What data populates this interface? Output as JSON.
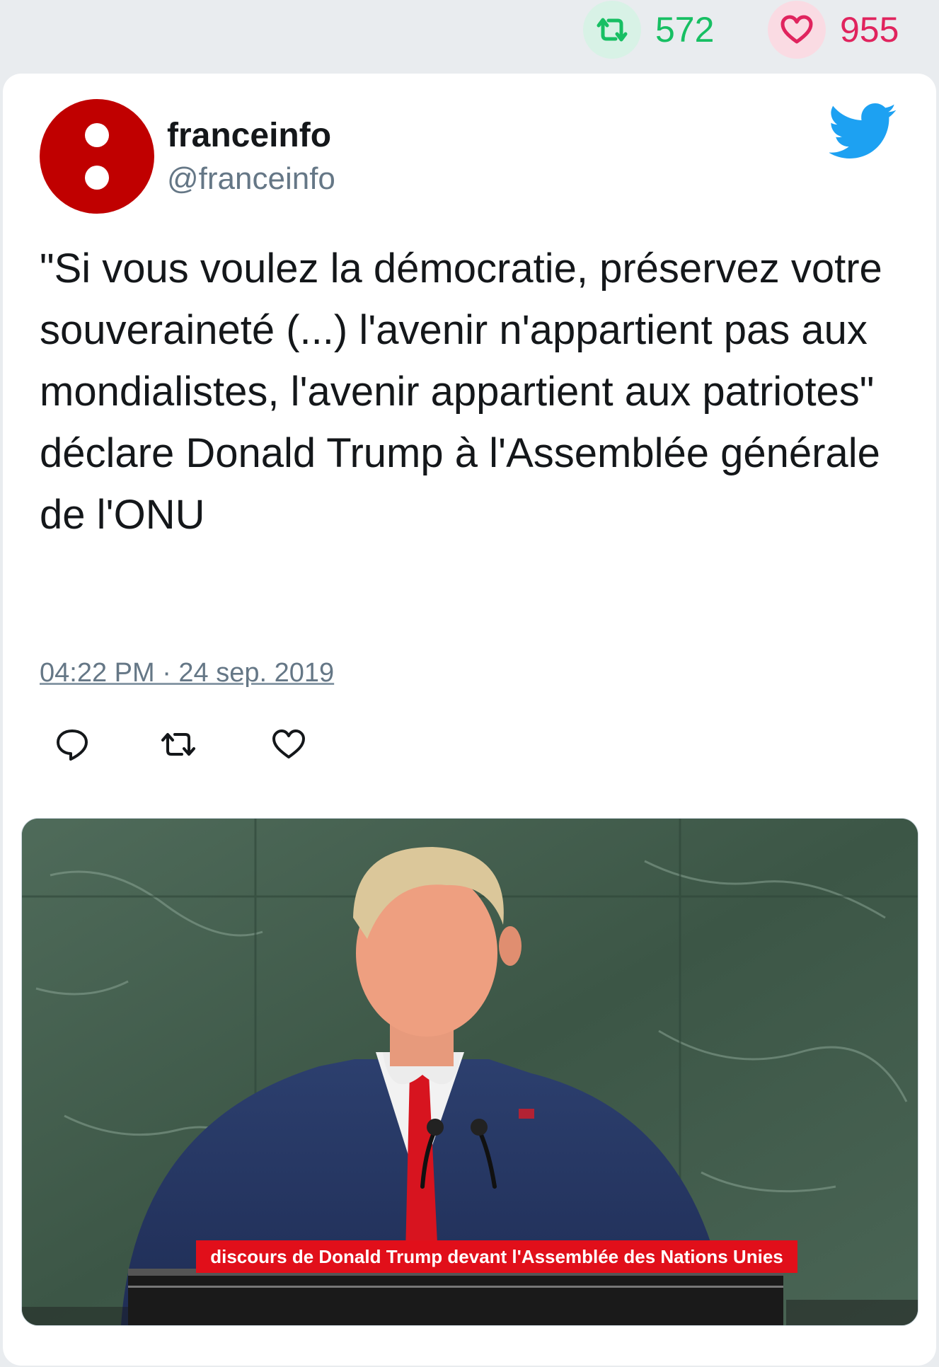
{
  "stats": {
    "retweets": "572",
    "likes": "955"
  },
  "tweet": {
    "author_name": "franceinfo",
    "author_handle": "@franceinfo",
    "text": "\"Si vous voulez la démocratie, préservez votre souveraineté (...) l'avenir n'appartient pas aux mondialistes, l'avenir appartient aux patriotes\" déclare Donald Trump à l'Assemblée générale de l'ONU",
    "timestamp": "04:22 PM · 24 sep. 2019"
  },
  "media": {
    "caption": "discours de Donald Trump devant l'Assemblée des Nations Unies"
  },
  "colors": {
    "retweet": "#17bf63",
    "like": "#e0245e",
    "twitter_blue": "#1da1f2",
    "avatar_red": "#c00000"
  },
  "icons": [
    "retweet-icon",
    "heart-icon",
    "twitter-bird-icon",
    "reply-icon",
    "retweet-action-icon",
    "like-action-icon"
  ]
}
